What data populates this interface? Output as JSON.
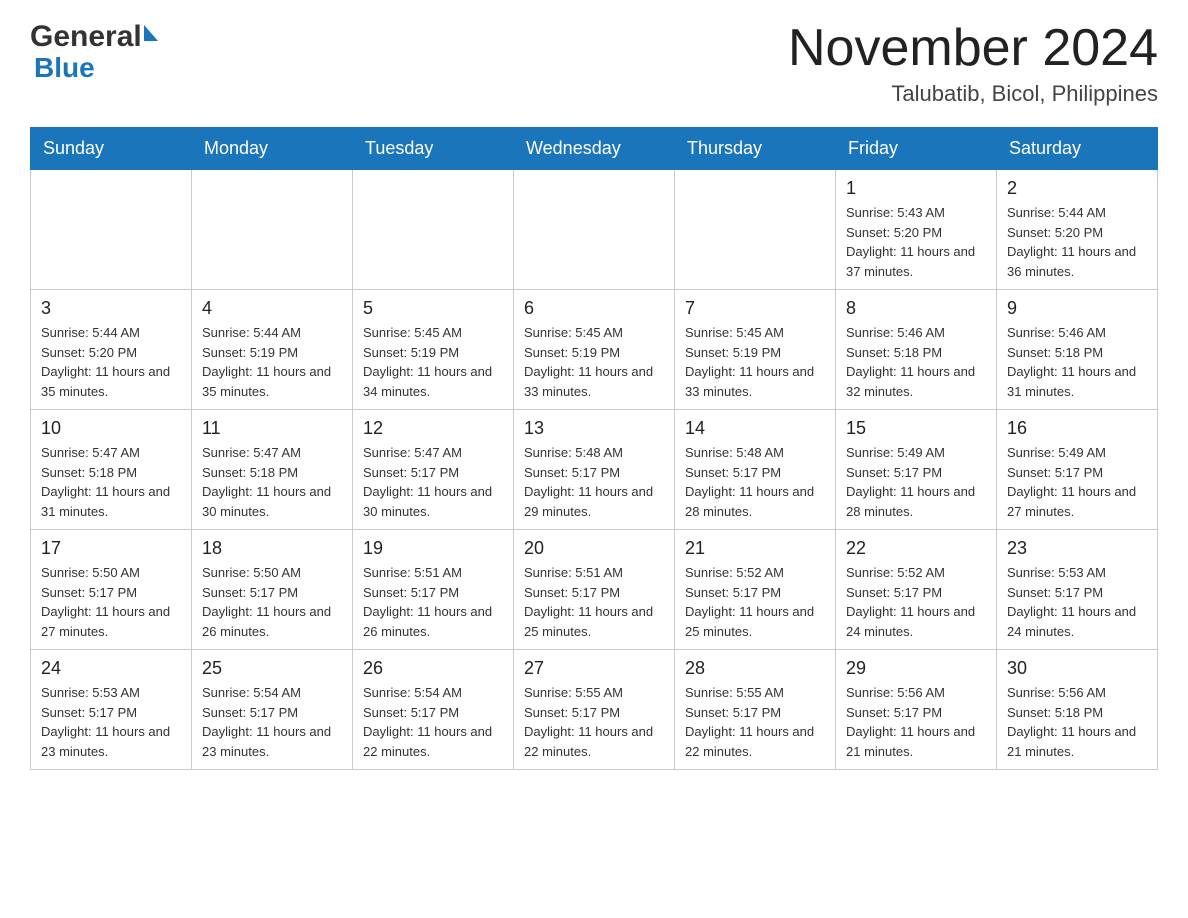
{
  "header": {
    "logo_general": "General",
    "logo_blue": "Blue",
    "month_year": "November 2024",
    "location": "Talubatib, Bicol, Philippines"
  },
  "days_of_week": [
    "Sunday",
    "Monday",
    "Tuesday",
    "Wednesday",
    "Thursday",
    "Friday",
    "Saturday"
  ],
  "weeks": [
    {
      "days": [
        {
          "number": "",
          "info": ""
        },
        {
          "number": "",
          "info": ""
        },
        {
          "number": "",
          "info": ""
        },
        {
          "number": "",
          "info": ""
        },
        {
          "number": "",
          "info": ""
        },
        {
          "number": "1",
          "info": "Sunrise: 5:43 AM\nSunset: 5:20 PM\nDaylight: 11 hours and 37 minutes."
        },
        {
          "number": "2",
          "info": "Sunrise: 5:44 AM\nSunset: 5:20 PM\nDaylight: 11 hours and 36 minutes."
        }
      ]
    },
    {
      "days": [
        {
          "number": "3",
          "info": "Sunrise: 5:44 AM\nSunset: 5:20 PM\nDaylight: 11 hours and 35 minutes."
        },
        {
          "number": "4",
          "info": "Sunrise: 5:44 AM\nSunset: 5:19 PM\nDaylight: 11 hours and 35 minutes."
        },
        {
          "number": "5",
          "info": "Sunrise: 5:45 AM\nSunset: 5:19 PM\nDaylight: 11 hours and 34 minutes."
        },
        {
          "number": "6",
          "info": "Sunrise: 5:45 AM\nSunset: 5:19 PM\nDaylight: 11 hours and 33 minutes."
        },
        {
          "number": "7",
          "info": "Sunrise: 5:45 AM\nSunset: 5:19 PM\nDaylight: 11 hours and 33 minutes."
        },
        {
          "number": "8",
          "info": "Sunrise: 5:46 AM\nSunset: 5:18 PM\nDaylight: 11 hours and 32 minutes."
        },
        {
          "number": "9",
          "info": "Sunrise: 5:46 AM\nSunset: 5:18 PM\nDaylight: 11 hours and 31 minutes."
        }
      ]
    },
    {
      "days": [
        {
          "number": "10",
          "info": "Sunrise: 5:47 AM\nSunset: 5:18 PM\nDaylight: 11 hours and 31 minutes."
        },
        {
          "number": "11",
          "info": "Sunrise: 5:47 AM\nSunset: 5:18 PM\nDaylight: 11 hours and 30 minutes."
        },
        {
          "number": "12",
          "info": "Sunrise: 5:47 AM\nSunset: 5:17 PM\nDaylight: 11 hours and 30 minutes."
        },
        {
          "number": "13",
          "info": "Sunrise: 5:48 AM\nSunset: 5:17 PM\nDaylight: 11 hours and 29 minutes."
        },
        {
          "number": "14",
          "info": "Sunrise: 5:48 AM\nSunset: 5:17 PM\nDaylight: 11 hours and 28 minutes."
        },
        {
          "number": "15",
          "info": "Sunrise: 5:49 AM\nSunset: 5:17 PM\nDaylight: 11 hours and 28 minutes."
        },
        {
          "number": "16",
          "info": "Sunrise: 5:49 AM\nSunset: 5:17 PM\nDaylight: 11 hours and 27 minutes."
        }
      ]
    },
    {
      "days": [
        {
          "number": "17",
          "info": "Sunrise: 5:50 AM\nSunset: 5:17 PM\nDaylight: 11 hours and 27 minutes."
        },
        {
          "number": "18",
          "info": "Sunrise: 5:50 AM\nSunset: 5:17 PM\nDaylight: 11 hours and 26 minutes."
        },
        {
          "number": "19",
          "info": "Sunrise: 5:51 AM\nSunset: 5:17 PM\nDaylight: 11 hours and 26 minutes."
        },
        {
          "number": "20",
          "info": "Sunrise: 5:51 AM\nSunset: 5:17 PM\nDaylight: 11 hours and 25 minutes."
        },
        {
          "number": "21",
          "info": "Sunrise: 5:52 AM\nSunset: 5:17 PM\nDaylight: 11 hours and 25 minutes."
        },
        {
          "number": "22",
          "info": "Sunrise: 5:52 AM\nSunset: 5:17 PM\nDaylight: 11 hours and 24 minutes."
        },
        {
          "number": "23",
          "info": "Sunrise: 5:53 AM\nSunset: 5:17 PM\nDaylight: 11 hours and 24 minutes."
        }
      ]
    },
    {
      "days": [
        {
          "number": "24",
          "info": "Sunrise: 5:53 AM\nSunset: 5:17 PM\nDaylight: 11 hours and 23 minutes."
        },
        {
          "number": "25",
          "info": "Sunrise: 5:54 AM\nSunset: 5:17 PM\nDaylight: 11 hours and 23 minutes."
        },
        {
          "number": "26",
          "info": "Sunrise: 5:54 AM\nSunset: 5:17 PM\nDaylight: 11 hours and 22 minutes."
        },
        {
          "number": "27",
          "info": "Sunrise: 5:55 AM\nSunset: 5:17 PM\nDaylight: 11 hours and 22 minutes."
        },
        {
          "number": "28",
          "info": "Sunrise: 5:55 AM\nSunset: 5:17 PM\nDaylight: 11 hours and 22 minutes."
        },
        {
          "number": "29",
          "info": "Sunrise: 5:56 AM\nSunset: 5:17 PM\nDaylight: 11 hours and 21 minutes."
        },
        {
          "number": "30",
          "info": "Sunrise: 5:56 AM\nSunset: 5:18 PM\nDaylight: 11 hours and 21 minutes."
        }
      ]
    }
  ]
}
